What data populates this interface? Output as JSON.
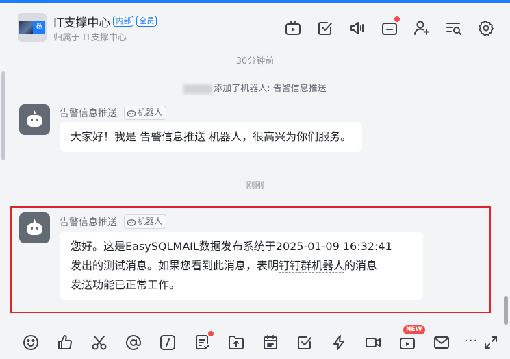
{
  "header": {
    "title": "IT支撑中心",
    "badges": [
      "内部",
      "全员"
    ],
    "subtitle": "归属于 IT支撑中心",
    "avatar_tag": "杨",
    "icons": [
      "tv-icon",
      "checkbox-icon",
      "speaker-icon",
      "tray-icon",
      "add-person-icon",
      "search-list-icon",
      "settings-icon"
    ]
  },
  "chat": {
    "time_sep_1": "30分钟前",
    "system_message": "添加了机器人: 告警信息推送",
    "messages": [
      {
        "sender": "告警信息推送",
        "bot_tag": "机器人",
        "text": "大家好！我是 告警信息推送 机器人，很高兴为你们服务。"
      },
      {
        "sender": "告警信息推送",
        "bot_tag": "机器人",
        "line1": "您好。这是EasySQLMAIL数据发布系统于2025-01-09 16:32:41",
        "line2_a": "发出的测试消息。如果您看到此消息，表明",
        "line2_link": "钉钉群机器人",
        "line2_b": "的消息",
        "line3": "发送功能已正常工作。"
      }
    ],
    "time_sep_2": "刚刚"
  },
  "inputbar": {
    "icons": [
      "emoji-icon",
      "thumbs-up-icon",
      "scissors-icon",
      "at-icon",
      "slash-command-icon",
      "doc-icon",
      "upload-icon",
      "calendar-icon",
      "task-check-icon",
      "lightning-icon",
      "video-icon",
      "live-icon",
      "mail-icon",
      "more-icon",
      "expand-icon"
    ],
    "new_badge": "NEW",
    "more_label": "···"
  },
  "colors": {
    "accent": "#1d7dff",
    "highlight": "#e0242b",
    "red_dot": "#f54a45"
  }
}
